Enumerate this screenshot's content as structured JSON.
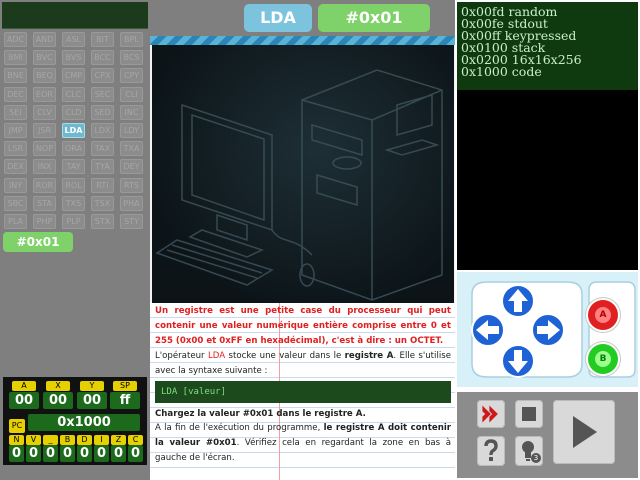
{
  "header": {
    "op_label": "LDA",
    "value_label": "#0x01"
  },
  "opcodes": [
    [
      "ADC",
      "AND",
      "ASL",
      "BIT",
      "BPL"
    ],
    [
      "BMI",
      "BVC",
      "BVS",
      "BCC",
      "BCS"
    ],
    [
      "BNE",
      "BEQ",
      "CMP",
      "CPX",
      "CPY"
    ],
    [
      "DEC",
      "EOR",
      "CLC",
      "SEC",
      "CLI"
    ],
    [
      "SEI",
      "CLV",
      "CLD",
      "SED",
      "INC"
    ],
    [
      "JMP",
      "JSR",
      "LDA",
      "LDX",
      "LDY"
    ],
    [
      "LSR",
      "NOP",
      "ORA",
      "TAX",
      "TXA"
    ],
    [
      "DEX",
      "INX",
      "TAY",
      "TYA",
      "DEY"
    ],
    [
      "INY",
      "ROR",
      "ROL",
      "RTI",
      "RTS"
    ],
    [
      "SBC",
      "STA",
      "TXS",
      "TSX",
      "PHA"
    ],
    [
      "PLA",
      "PHP",
      "PLP",
      "STX",
      "STY"
    ]
  ],
  "selected_opcode": "LDA",
  "selected_value": "#0x01",
  "registers": {
    "a_label": "A",
    "x_label": "X",
    "y_label": "Y",
    "sp_label": "SP",
    "a": "00",
    "x": "00",
    "y": "00",
    "sp": "ff",
    "pc_label": "PC",
    "pc": "0x1000",
    "flag_labels": [
      "N",
      "V",
      "_",
      "B",
      "D",
      "I",
      "Z",
      "C"
    ],
    "flags": [
      "0",
      "0",
      "0",
      "0",
      "0",
      "0",
      "0",
      "0"
    ]
  },
  "memory_map": [
    "0x00fd random",
    "0x00fe stdout",
    "0x00ff keypressed",
    "0x0100 stack",
    "0x0200 16x16x256",
    "0x1000 code"
  ],
  "lesson": {
    "p1": "Un registre est une petite case du processeur qui peut contenir une valeur numérique entière comprise entre 0 et 255 (0x00 et 0xFF en hexadécimal), c'est à dire : un OCTET.",
    "p2_a": "L'opérateur ",
    "p2_op": "LDA",
    "p2_b": " stocke une valeur dans le ",
    "p2_reg": "registre A",
    "p2_c": ". Elle s'utilise avec la syntaxe suivante :",
    "code": "LDA [valeur]",
    "task": "Chargez la valeur #0x01 dans le registre A.",
    "p3_a": "A la fin de l'exécution du programme, ",
    "p3_b": "le registre A doit contenir la valeur #0x01",
    "p3_c": ". Vérifiez cela en regardant la zone en bas à gauche de l'écran."
  },
  "gamepad": {
    "a_label": "A",
    "b_label": "B"
  },
  "controls": {
    "hint_count": "3"
  },
  "colors": {
    "accent_blue": "#7cc3de",
    "accent_green": "#7fd16a",
    "btn_red": "#e02020",
    "btn_green": "#22cc22"
  }
}
